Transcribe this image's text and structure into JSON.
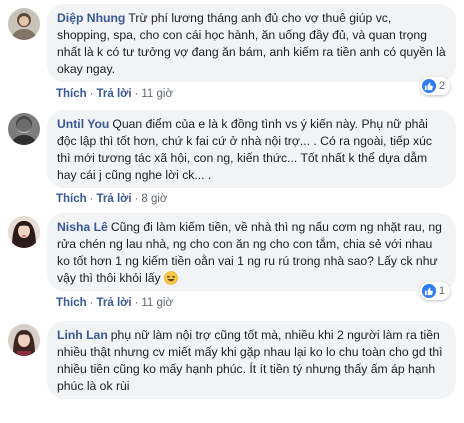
{
  "comments": [
    {
      "author": "Diệp Nhung",
      "text": "Trừ phí lương tháng anh đủ cho vợ thuê giúp vc, shopping, spa, cho con cái học hành, ăn uống đầy đủ, và quan trọng nhất là k có tư tưởng vợ đang ăn bám, anh kiếm ra tiền anh có quyền là okay ngay.",
      "like_label": "Thích",
      "reply_label": "Trả lời",
      "time": "11 giờ",
      "reaction_count": "2"
    },
    {
      "author": "Until You",
      "text": "Quan điểm của e là k đồng tình vs ý kiến này. Phụ nữ phải độc lập thì tốt hơn, chứ k fai cứ ở nhà nội trợ... . Có ra ngoài, tiếp xúc thì mới tương tác xã hội, con ng, kiến thức... Tốt nhất k thể dựa dẫm hay cái j cũng nghe lời ck... .",
      "like_label": "Thích",
      "reply_label": "Trả lời",
      "time": "8 giờ"
    },
    {
      "author": "Nisha Lê",
      "text": "Cũng đi làm kiếm tiền, về nhà thì ng nấu cơm ng nhặt rau, ng rửa chén ng lau nhà, ng cho con ăn ng cho con tắm, chia sẻ với nhau ko tốt hơn 1 ng kiếm tiền oằn vai 1 ng ru rú trong nhà sao? Lấy ck như vậy thì thôi khỏi lấy",
      "like_label": "Thích",
      "reply_label": "Trả lời",
      "time": "11 giờ",
      "reaction_count": "1"
    },
    {
      "author": "Linh Lan",
      "text": "phụ nữ làm nội trợ cũng tốt mà, nhiều khi 2 người làm ra tiền nhiều thật nhưng cv miết mấy khi gặp nhau lại ko lo chu toàn cho gd thì nhiều tiền cũng ko mấy hạnh phúc. Ít ít tiền tý nhưng thấy ấm áp hạnh phúc là ok rùi"
    }
  ],
  "colors": {
    "author": "#385898",
    "bubble": "#f2f3f5",
    "like": "#2e7bf6"
  }
}
